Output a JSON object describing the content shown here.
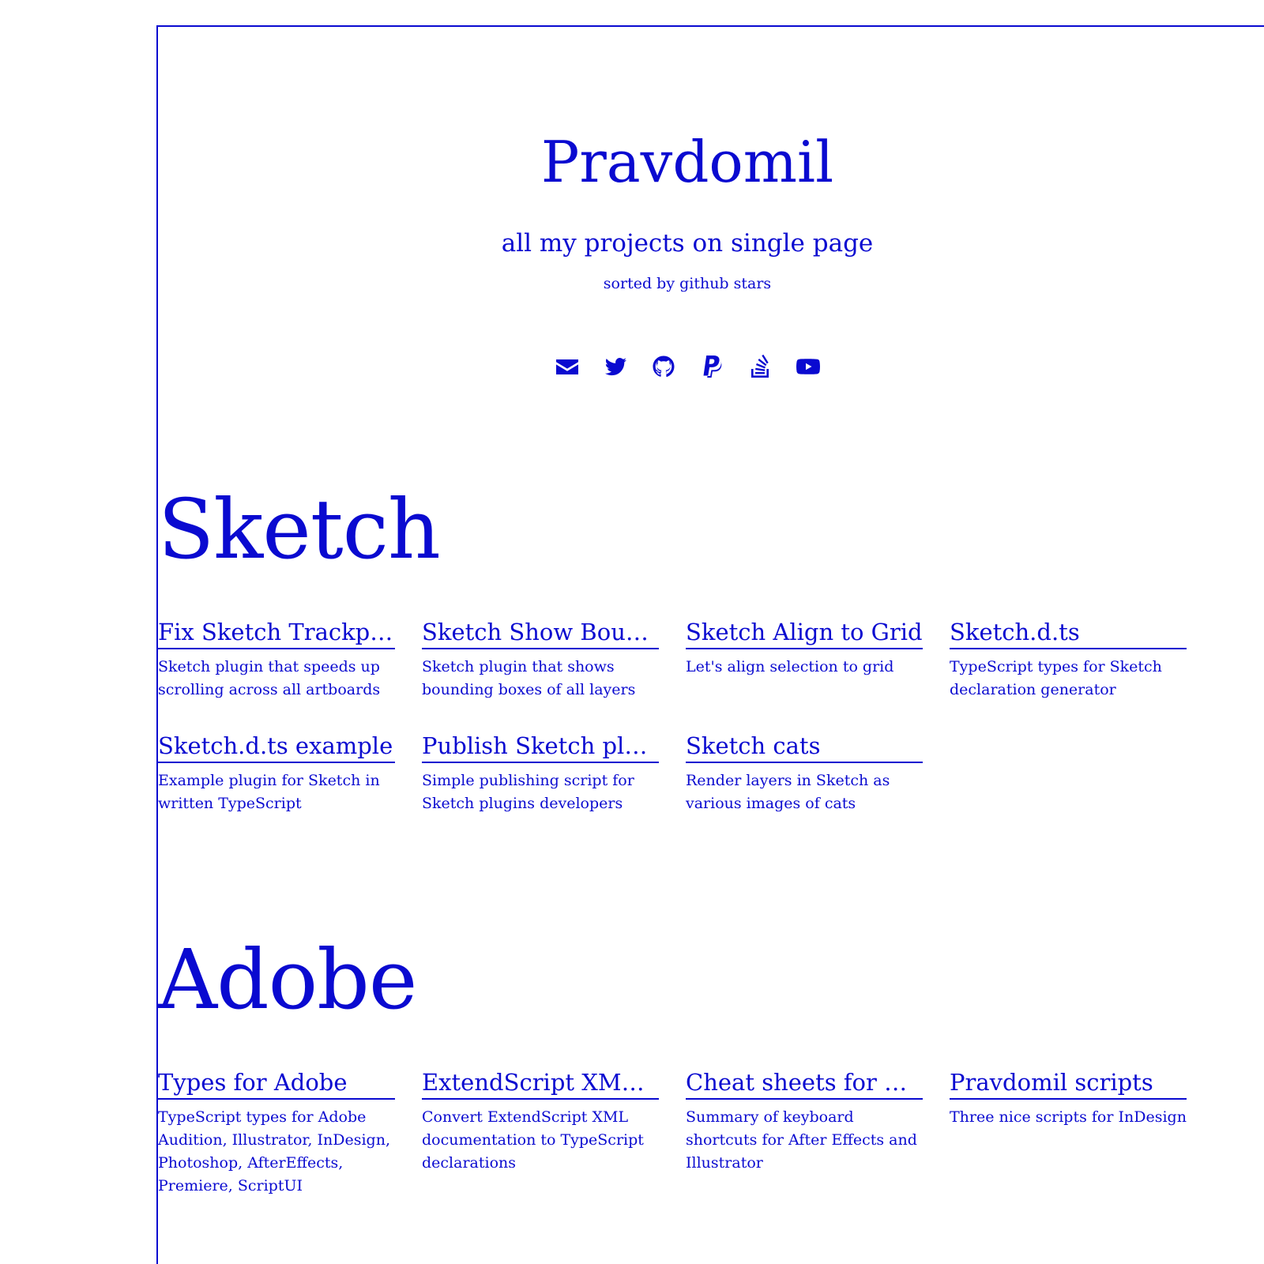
{
  "header": {
    "title": "Pravdomil",
    "tagline": "all my projects on single page",
    "sort_note": "sorted by github stars"
  },
  "socials": [
    {
      "icon": "envelope-icon",
      "label": "email"
    },
    {
      "icon": "twitter-icon",
      "label": "twitter"
    },
    {
      "icon": "github-icon",
      "label": "github"
    },
    {
      "icon": "paypal-icon",
      "label": "paypal"
    },
    {
      "icon": "stackoverflow-icon",
      "label": "stackoverflow"
    },
    {
      "icon": "youtube-icon",
      "label": "youtube"
    }
  ],
  "sections": [
    {
      "title": "Sketch",
      "projects": [
        {
          "name": "Fix Sketch Trackpa...",
          "description": "Sketch plugin that speeds up scrolling across all artboards"
        },
        {
          "name": "Sketch Show Boun...",
          "description": "Sketch plugin that shows bounding boxes of all layers"
        },
        {
          "name": "Sketch Align to Grid",
          "description": "Let's align selection to grid"
        },
        {
          "name": "Sketch.d.ts",
          "description": "TypeScript types for Sketch declaration generator"
        },
        {
          "name": "Sketch.d.ts example",
          "description": "Example plugin for Sketch in written TypeScript"
        },
        {
          "name": "Publish Sketch plu...",
          "description": "Simple publishing script for Sketch plugins developers"
        },
        {
          "name": "Sketch cats",
          "description": "Render layers in Sketch as various images of cats"
        }
      ]
    },
    {
      "title": "Adobe",
      "projects": [
        {
          "name": "Types for Adobe",
          "description": "TypeScript types for Adobe Audition, Illustrator, InDesign, Photoshop, AfterEffects, Premiere, ScriptUI"
        },
        {
          "name": "ExtendScript XML ...",
          "description": "Convert ExtendScript XML documentation to TypeScript declarations"
        },
        {
          "name": "Cheat sheets for Ad...",
          "description": "Summary of keyboard shortcuts for After Effects and Illustrator"
        },
        {
          "name": "Pravdomil scripts",
          "description": "Three nice scripts for InDesign"
        }
      ]
    }
  ],
  "colors": {
    "accent": "#0a0ad0",
    "background": "#ffffff"
  }
}
